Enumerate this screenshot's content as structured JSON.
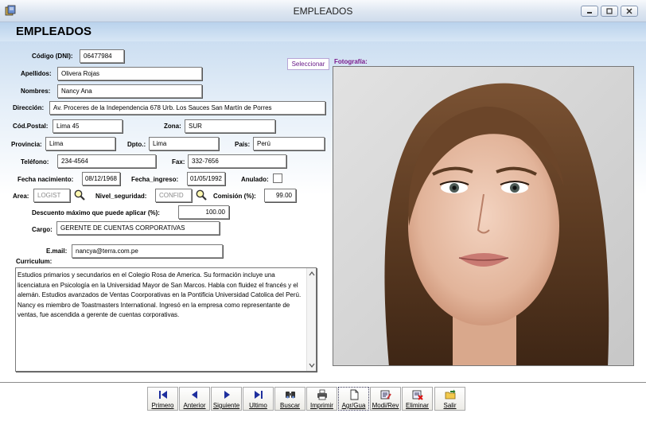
{
  "window": {
    "title": "EMPLEADOS"
  },
  "form": {
    "title": "EMPLEADOS",
    "fields": {
      "codigo": {
        "label": "Código (DNI):",
        "value": "06477984"
      },
      "apellidos": {
        "label": "Apellidos:",
        "value": "Olivera Rojas"
      },
      "nombres": {
        "label": "Nombres:",
        "value": "Nancy Ana"
      },
      "direccion": {
        "label": "Dirección:",
        "value": "Av. Proceres de la Independencia 678 Urb. Los Sauces San Martín de Porres"
      },
      "cod_postal": {
        "label": "Cód.Postal:",
        "value": "Lima 45"
      },
      "zona": {
        "label": "Zona:",
        "value": "SUR"
      },
      "provincia": {
        "label": "Provincia:",
        "value": "Lima"
      },
      "dpto": {
        "label": "Dpto.:",
        "value": "Lima"
      },
      "pais": {
        "label": "País:",
        "value": "Perú"
      },
      "telefono": {
        "label": "Teléfono:",
        "value": "234-4564"
      },
      "fax": {
        "label": "Fax:",
        "value": "332-7656"
      },
      "fecha_nacimiento": {
        "label": "Fecha nacimiento:",
        "value": "08/12/1968"
      },
      "fecha_ingreso": {
        "label": "Fecha_ingreso:",
        "value": "01/05/1992"
      },
      "anulado": {
        "label": "Anulado:",
        "checked": false
      },
      "area": {
        "label": "Area:",
        "value": "LOGIST"
      },
      "nivel_seguridad": {
        "label": "Nivel_seguridad:",
        "value": "CONFID"
      },
      "comision": {
        "label": "Comisión (%):",
        "value": "99.00"
      },
      "descuento": {
        "label": "Descuento máximo que puede aplicar (%):",
        "value": "100.00"
      },
      "cargo": {
        "label": "Cargo:",
        "value": "GERENTE DE CUENTAS CORPORATIVAS"
      },
      "email": {
        "label": "E.mail:",
        "value": "nancya@terra.com.pe"
      }
    },
    "curriculum": {
      "label": "Curriculum:",
      "value": "Estudios primarios y secundarios en el Colegio Rosa de America. Su formación incluye una licenciatura en Psicología en la Universidad Mayor de San Marcos. Habla con fluidez el francés y el alemán. Estudios avanzados de Ventas Coorporativas en la Pontificia Universidad Catolica del Perú. Nancy es miembro de Toastmasters International. Ingresó en la empresa como representante de ventas, fue ascendida a gerente de cuentas corporativas."
    },
    "photo": {
      "select_label": "Seleccionar",
      "label": "Fotografía:"
    }
  },
  "toolbar": {
    "buttons": [
      {
        "label": "Primero",
        "icon": "first-record-icon"
      },
      {
        "label": "Anterior",
        "icon": "previous-record-icon"
      },
      {
        "label": "Siguiente",
        "icon": "next-record-icon"
      },
      {
        "label": "Ultimo",
        "icon": "last-record-icon"
      },
      {
        "label": "Buscar",
        "icon": "binoculars-icon"
      },
      {
        "label": "Imprimir",
        "icon": "printer-icon"
      },
      {
        "label": "Agr/Gua",
        "icon": "new-document-icon"
      },
      {
        "label": "Modi/Rev",
        "icon": "edit-document-icon"
      },
      {
        "label": "Eliminar",
        "icon": "delete-document-icon"
      },
      {
        "label": "Salir",
        "icon": "exit-folder-icon"
      }
    ]
  },
  "colors": {
    "header_blue": "#b9d2ec",
    "photo_label_purple": "#7a1a8c",
    "nav_icon_blue": "#1e2f9e"
  }
}
